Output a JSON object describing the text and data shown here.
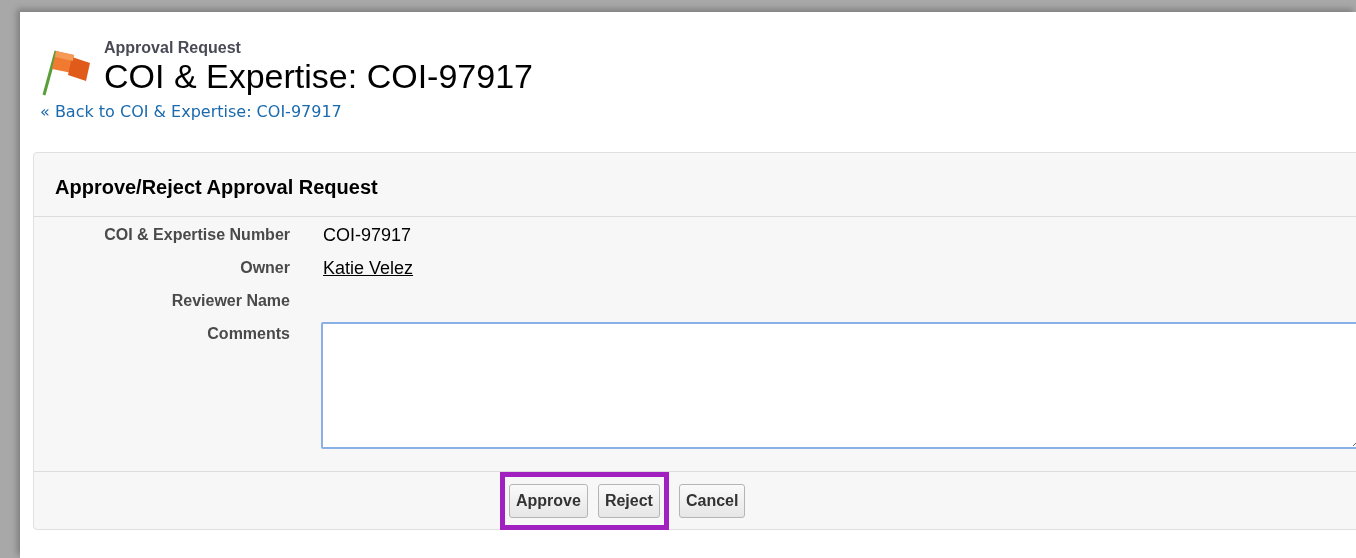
{
  "page_header": {
    "subtitle": "Approval Request",
    "title": "COI & Expertise: COI-97917",
    "back_link": "« Back to COI & Expertise: COI-97917"
  },
  "panel": {
    "title": "Approve/Reject Approval Request",
    "fields": [
      {
        "label": "COI & Expertise Number",
        "kind": "text",
        "value": "COI-97917"
      },
      {
        "label": "Owner",
        "kind": "link",
        "value": "Katie Velez"
      },
      {
        "label": "Reviewer Name",
        "kind": "text"
      },
      {
        "label": "Comments",
        "kind": "textarea"
      }
    ],
    "buttons": [
      {
        "label": "Approve",
        "highlighted": true
      },
      {
        "label": "Reject",
        "highlighted": true
      },
      {
        "label": "Cancel",
        "highlighted": false
      }
    ]
  }
}
